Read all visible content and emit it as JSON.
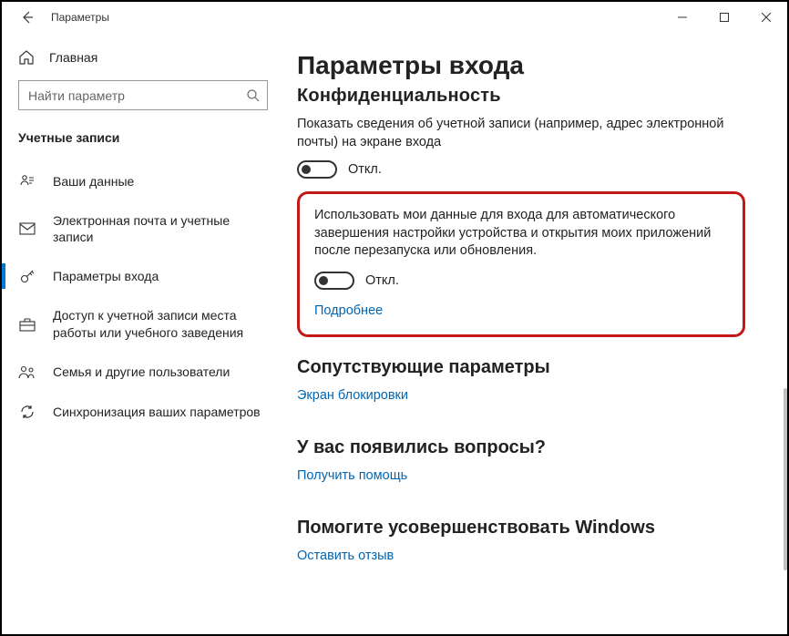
{
  "window": {
    "title": "Параметры"
  },
  "sidebar": {
    "home": "Главная",
    "search_placeholder": "Найти параметр",
    "section": "Учетные записи",
    "items": [
      {
        "label": "Ваши данные"
      },
      {
        "label": "Электронная почта и учетные записи"
      },
      {
        "label": "Параметры входа"
      },
      {
        "label": "Доступ к учетной записи места работы или учебного заведения"
      },
      {
        "label": "Семья и другие пользователи"
      },
      {
        "label": "Синхронизация ваших параметров"
      }
    ]
  },
  "main": {
    "title": "Параметры входа",
    "privacy_heading": "Конфиденциальность",
    "para1": "Показать сведения об учетной записи (например, адрес электронной почты) на экране входа",
    "toggle_off": "Откл.",
    "para2": "Использовать мои данные для входа для автоматического завершения настройки устройства и открытия моих приложений после перезапуска или обновления.",
    "learn_more": "Подробнее",
    "related_heading": "Сопутствующие параметры",
    "related_link": "Экран блокировки",
    "help_heading": "У вас появились вопросы?",
    "help_link": "Получить помощь",
    "feedback_heading": "Помогите усовершенствовать Windows",
    "feedback_link": "Оставить отзыв"
  }
}
